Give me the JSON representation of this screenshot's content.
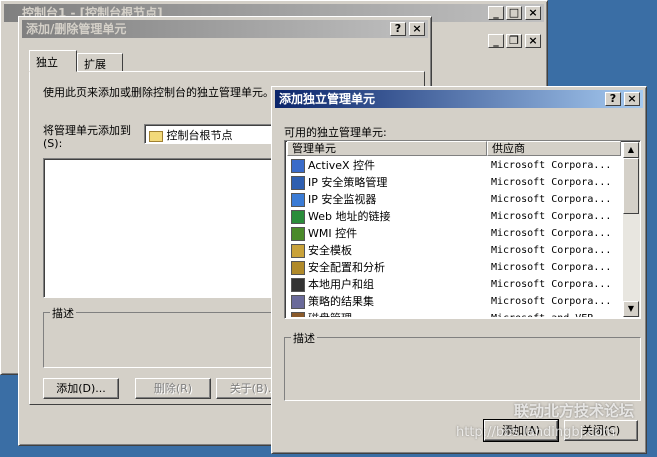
{
  "console_window": {
    "title": "控制台1 - [控制台根节点]"
  },
  "add_remove_dialog": {
    "title": "添加/删除管理单元",
    "help_button": "?",
    "close_button": "×",
    "tabs": [
      "独立",
      "扩展"
    ],
    "description": "使用此页来添加或删除控制台的独立管理单元。",
    "add_to_label": "将管理单元添加到(S):",
    "add_to_value": "控制台根节点",
    "describe_group": "描述",
    "buttons": {
      "add": "添加(D)...",
      "remove": "删除(R)",
      "about": "关于(B)..."
    }
  },
  "add_standalone_dialog": {
    "title": "添加独立管理单元",
    "help_button": "?",
    "close_button": "×",
    "available_label": "可用的独立管理单元:",
    "columns": [
      "管理单元",
      "供应商"
    ],
    "items": [
      {
        "name": "ActiveX 控件",
        "vendor": "Microsoft Corpora...",
        "icon": "activex-icon"
      },
      {
        "name": "IP 安全策略管理",
        "vendor": "Microsoft Corpora...",
        "icon": "ip-security-policy-icon"
      },
      {
        "name": "IP 安全监视器",
        "vendor": "Microsoft Corpora...",
        "icon": "ip-security-monitor-icon"
      },
      {
        "name": "Web 地址的链接",
        "vendor": "Microsoft Corpora...",
        "icon": "web-link-icon"
      },
      {
        "name": "WMI 控件",
        "vendor": "Microsoft Corpora...",
        "icon": "wmi-icon"
      },
      {
        "name": "安全模板",
        "vendor": "Microsoft Corpora...",
        "icon": "security-template-icon"
      },
      {
        "name": "安全配置和分析",
        "vendor": "Microsoft Corpora...",
        "icon": "security-config-icon"
      },
      {
        "name": "本地用户和组",
        "vendor": "Microsoft Corpora...",
        "icon": "local-users-icon"
      },
      {
        "name": "策略的结果集",
        "vendor": "Microsoft Corpora...",
        "icon": "rsop-icon"
      },
      {
        "name": "磁盘管理",
        "vendor": "Microsoft and VER...",
        "icon": "disk-management-icon"
      }
    ],
    "describe_group": "描述",
    "buttons": {
      "add": "添加(A)",
      "close": "关闭(C)"
    }
  },
  "watermark": {
    "line1": "联动北方技术论坛",
    "line2": "http://bbs.landingbj.com"
  }
}
